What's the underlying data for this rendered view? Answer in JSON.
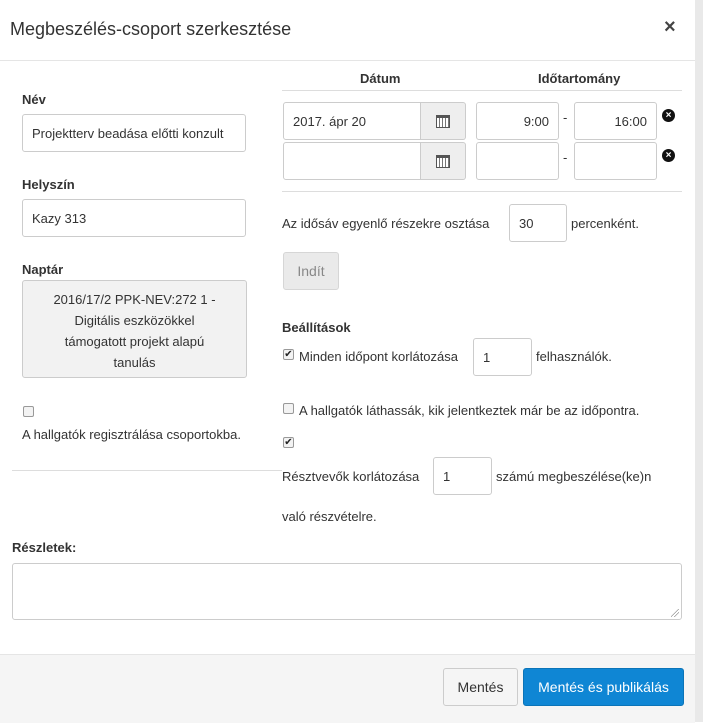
{
  "modal": {
    "title": "Megbeszélés-csoport szerkesztése",
    "close": "×"
  },
  "left": {
    "name_label": "Név",
    "name_value": "Projektterv beadása előtti konzult",
    "location_label": "Helyszín",
    "location_value": "Kazy 313",
    "calendar_label": "Naptár",
    "calendar_lines": [
      "2016/17/2 PPK-NEV:272 1 -",
      "Digitális eszközökkel",
      "támogatott projekt alapú",
      "tanulás"
    ],
    "group_reg_checked": false,
    "group_reg_label": "A hallgatók regisztrálása csoportokba."
  },
  "schedule": {
    "col_date": "Dátum",
    "col_time": "Időtartomány",
    "rows": [
      {
        "date": "2017. ápr 20",
        "start": "9:00",
        "sep": "-",
        "end": "16:00"
      },
      {
        "date": "",
        "start": "",
        "sep": "-",
        "end": ""
      }
    ],
    "split_prefix": "Az idősáv egyenlő részekre osztása",
    "split_value": "30",
    "split_suffix": "percenként.",
    "start_button": "Indít"
  },
  "settings": {
    "heading": "Beállítások",
    "limit_checked": true,
    "limit_prefix": "Minden időpont korlátozása",
    "limit_value": "1",
    "limit_suffix": "felhasználók.",
    "visible_checked": false,
    "visible_label": "A hallgatók láthassák, kik jelentkeztek már be az időpontra.",
    "participants_checked": true,
    "participants_prefix": "Résztvevők korlátozása",
    "participants_value": "1",
    "participants_suffix": "számú megbeszélése(ke)n",
    "participants_suffix2": "való részvételre."
  },
  "details": {
    "label": "Részletek:",
    "value": ""
  },
  "footer": {
    "save": "Mentés",
    "save_publish": "Mentés és publikálás"
  },
  "colors": {
    "primary": "#0f86d4",
    "primary_border": "#0b74b8"
  }
}
